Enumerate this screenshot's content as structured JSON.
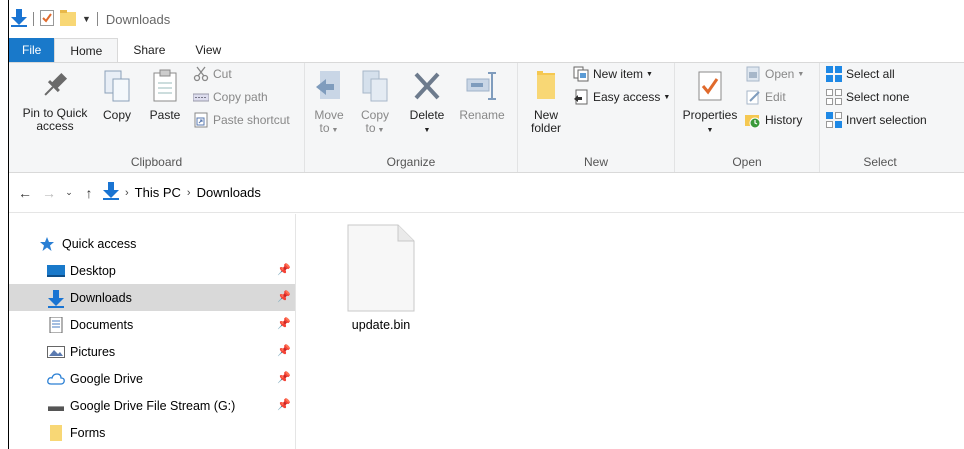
{
  "titlebar": {
    "title": "Downloads"
  },
  "tabs": [
    {
      "label": "File"
    },
    {
      "label": "Home"
    },
    {
      "label": "Share"
    },
    {
      "label": "View"
    }
  ],
  "ribbon": {
    "clipboard": {
      "label": "Clipboard",
      "pin_line1": "Pin to Quick",
      "pin_line2": "access",
      "copy": "Copy",
      "paste": "Paste",
      "cut": "Cut",
      "copy_path": "Copy path",
      "paste_shortcut": "Paste shortcut"
    },
    "organize": {
      "label": "Organize",
      "move_line1": "Move",
      "move_line2": "to",
      "copy_line1": "Copy",
      "copy_line2": "to",
      "delete": "Delete",
      "rename": "Rename"
    },
    "new": {
      "label": "New",
      "folder_line1": "New",
      "folder_line2": "folder",
      "new_item": "New item",
      "easy_access": "Easy access"
    },
    "open": {
      "label": "Open",
      "properties": "Properties",
      "open": "Open",
      "edit": "Edit",
      "history": "History"
    },
    "select": {
      "label": "Select",
      "select_all": "Select all",
      "select_none": "Select none",
      "invert": "Invert selection"
    }
  },
  "address": {
    "crumbs": [
      "This PC",
      "Downloads"
    ]
  },
  "nav": {
    "quick_access": "Quick access",
    "items": [
      {
        "label": "Desktop",
        "pinned": true
      },
      {
        "label": "Downloads",
        "pinned": true,
        "selected": true
      },
      {
        "label": "Documents",
        "pinned": true
      },
      {
        "label": "Pictures",
        "pinned": true
      },
      {
        "label": "Google Drive",
        "pinned": true
      },
      {
        "label": "Google Drive File Stream (G:)",
        "pinned": true
      },
      {
        "label": "Forms",
        "pinned": false
      }
    ]
  },
  "files": [
    {
      "name": "update.bin"
    }
  ]
}
